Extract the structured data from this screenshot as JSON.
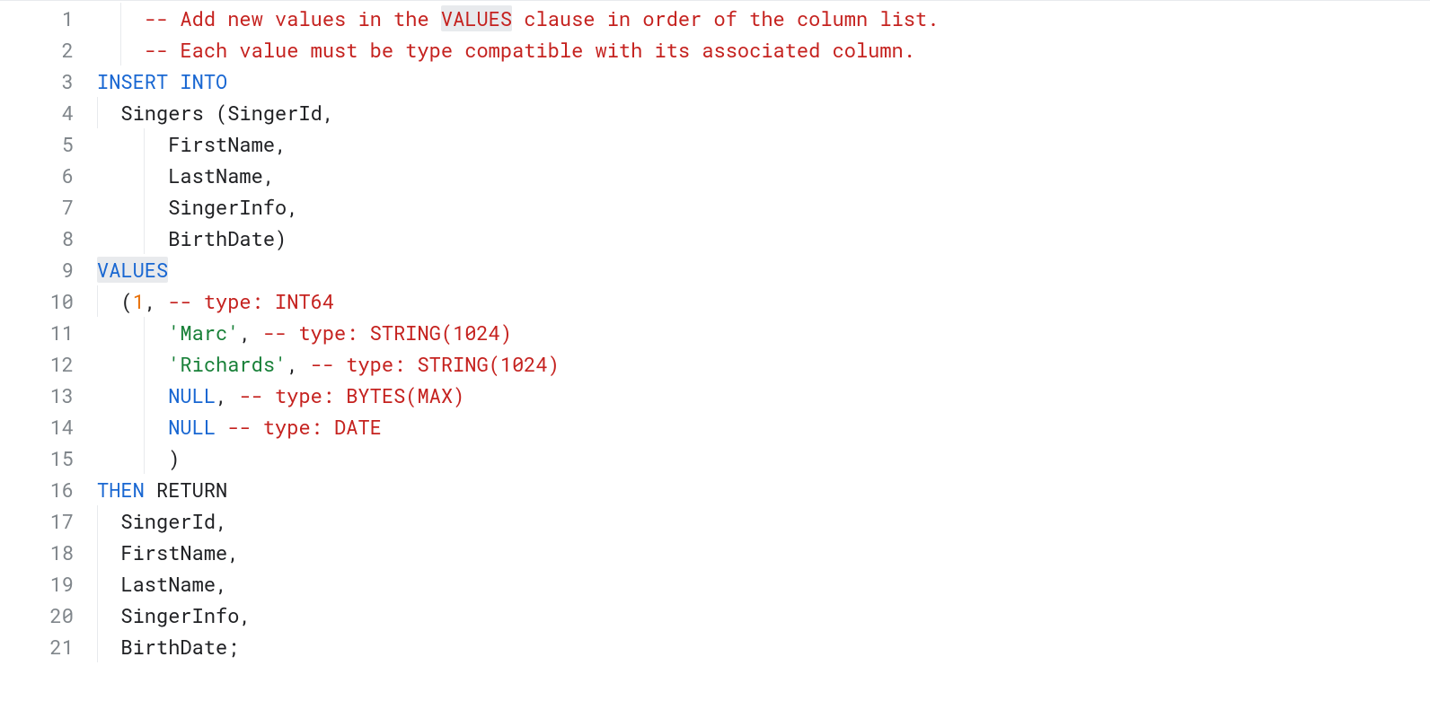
{
  "lineNumbers": [
    "1",
    "2",
    "3",
    "4",
    "5",
    "6",
    "7",
    "8",
    "9",
    "10",
    "11",
    "12",
    "13",
    "14",
    "15",
    "16",
    "17",
    "18",
    "19",
    "20",
    "21"
  ],
  "lines": [
    {
      "indent": 2,
      "tokens": [
        {
          "cls": "t-comment",
          "text": "-- Add new values in the "
        },
        {
          "cls": "t-comment hl",
          "text": "VALUES"
        },
        {
          "cls": "t-comment",
          "text": " clause in order of the column list."
        }
      ]
    },
    {
      "indent": 2,
      "tokens": [
        {
          "cls": "t-comment",
          "text": "-- Each value must be type compatible with its associated column."
        }
      ]
    },
    {
      "indent": 0,
      "tokens": [
        {
          "cls": "t-keyword",
          "text": "INSERT INTO"
        }
      ]
    },
    {
      "indent": 1,
      "tokens": [
        {
          "cls": "t-default",
          "text": "Singers (SingerId,"
        }
      ]
    },
    {
      "indent": 3,
      "tokens": [
        {
          "cls": "t-default",
          "text": "FirstName,"
        }
      ]
    },
    {
      "indent": 3,
      "tokens": [
        {
          "cls": "t-default",
          "text": "LastName,"
        }
      ]
    },
    {
      "indent": 3,
      "tokens": [
        {
          "cls": "t-default",
          "text": "SingerInfo,"
        }
      ]
    },
    {
      "indent": 3,
      "tokens": [
        {
          "cls": "t-default",
          "text": "BirthDate)"
        }
      ]
    },
    {
      "indent": 0,
      "tokens": [
        {
          "cls": "t-keyword hl",
          "text": "VALUES"
        }
      ]
    },
    {
      "indent": 1,
      "tokens": [
        {
          "cls": "t-paren",
          "text": "("
        },
        {
          "cls": "t-number",
          "text": "1"
        },
        {
          "cls": "t-default",
          "text": ", "
        },
        {
          "cls": "t-comment",
          "text": "-- type: INT64"
        }
      ]
    },
    {
      "indent": 3,
      "tokens": [
        {
          "cls": "t-string",
          "text": "'Marc'"
        },
        {
          "cls": "t-default",
          "text": ", "
        },
        {
          "cls": "t-comment",
          "text": "-- type: STRING(1024)"
        }
      ]
    },
    {
      "indent": 3,
      "tokens": [
        {
          "cls": "t-string",
          "text": "'Richards'"
        },
        {
          "cls": "t-default",
          "text": ", "
        },
        {
          "cls": "t-comment",
          "text": "-- type: STRING(1024)"
        }
      ]
    },
    {
      "indent": 3,
      "tokens": [
        {
          "cls": "t-keyword",
          "text": "NULL"
        },
        {
          "cls": "t-default",
          "text": ", "
        },
        {
          "cls": "t-comment",
          "text": "-- type: BYTES(MAX)"
        }
      ]
    },
    {
      "indent": 3,
      "tokens": [
        {
          "cls": "t-keyword",
          "text": "NULL"
        },
        {
          "cls": "t-default",
          "text": " "
        },
        {
          "cls": "t-comment",
          "text": "-- type: DATE"
        }
      ]
    },
    {
      "indent": 3,
      "tokens": [
        {
          "cls": "t-paren",
          "text": ")"
        }
      ]
    },
    {
      "indent": 0,
      "tokens": [
        {
          "cls": "t-keyword",
          "text": "THEN"
        },
        {
          "cls": "t-default",
          "text": " RETURN"
        }
      ]
    },
    {
      "indent": 1,
      "tokens": [
        {
          "cls": "t-default",
          "text": "SingerId,"
        }
      ]
    },
    {
      "indent": 1,
      "tokens": [
        {
          "cls": "t-default",
          "text": "FirstName,"
        }
      ]
    },
    {
      "indent": 1,
      "tokens": [
        {
          "cls": "t-default",
          "text": "LastName,"
        }
      ]
    },
    {
      "indent": 1,
      "tokens": [
        {
          "cls": "t-default",
          "text": "SingerInfo,"
        }
      ]
    },
    {
      "indent": 1,
      "tokens": [
        {
          "cls": "t-default",
          "text": "BirthDate;"
        }
      ]
    }
  ]
}
